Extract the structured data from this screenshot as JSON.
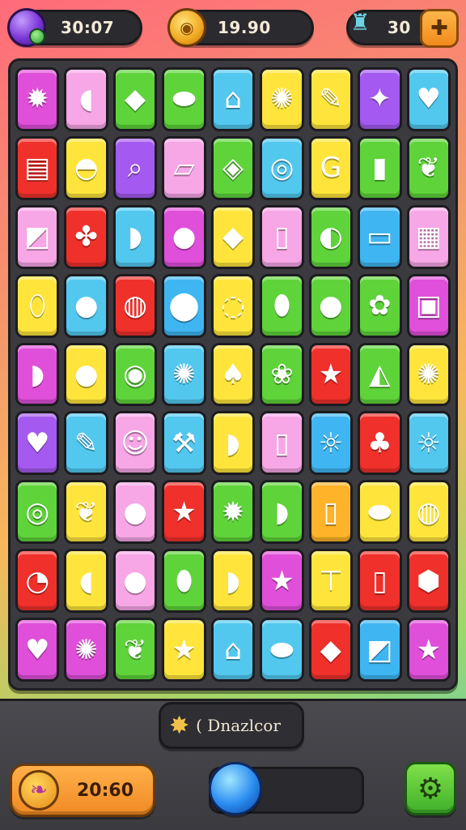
{
  "hud": {
    "gems": "30:07",
    "coins": "19.90",
    "cups": "30",
    "icons": {
      "gems": "gem-icon",
      "coins": "coin-icon",
      "cups": "trophy-lamp-icon",
      "shop": "shop-plus-icon"
    }
  },
  "board": {
    "rows": 9,
    "cols": 9,
    "tiles": [
      [
        {
          "c": "magenta",
          "g": "✹",
          "n": "virus"
        },
        {
          "c": "pink",
          "g": "◖",
          "n": "capsule"
        },
        {
          "c": "green",
          "g": "◆",
          "n": "drop"
        },
        {
          "c": "green",
          "g": "⬬",
          "n": "pin"
        },
        {
          "c": "lightblue",
          "g": "⌂",
          "n": "robot"
        },
        {
          "c": "yellow",
          "g": "✺",
          "n": "cookie"
        },
        {
          "c": "yellow",
          "g": "✎",
          "n": "tool"
        },
        {
          "c": "purple",
          "g": "✦",
          "n": "star"
        },
        {
          "c": "lightblue",
          "g": "♥",
          "n": "heart"
        }
      ],
      [
        {
          "c": "red",
          "g": "▤",
          "n": "jar"
        },
        {
          "c": "yellow",
          "g": "◓",
          "n": "bell"
        },
        {
          "c": "purple",
          "g": "⌕",
          "n": "horn"
        },
        {
          "c": "pink",
          "g": "▱",
          "n": "box"
        },
        {
          "c": "green",
          "g": "◈",
          "n": "gem"
        },
        {
          "c": "lightblue",
          "g": "◎",
          "n": "ring"
        },
        {
          "c": "yellow",
          "g": "G",
          "n": "letter"
        },
        {
          "c": "green",
          "g": "▮",
          "n": "battery"
        },
        {
          "c": "green",
          "g": "❦",
          "n": "leaf"
        }
      ],
      [
        {
          "c": "pink",
          "g": "◩",
          "n": "cube"
        },
        {
          "c": "red",
          "g": "✤",
          "n": "blob"
        },
        {
          "c": "lightblue",
          "g": "◗",
          "n": "leaf-drop"
        },
        {
          "c": "magenta",
          "g": "●",
          "n": "fruit"
        },
        {
          "c": "yellow",
          "g": "◆",
          "n": "crystal"
        },
        {
          "c": "pink",
          "g": "▯",
          "n": "tag"
        },
        {
          "c": "green",
          "g": "◐",
          "n": "banana"
        },
        {
          "c": "blue",
          "g": "▭",
          "n": "device"
        },
        {
          "c": "pink",
          "g": "▦",
          "n": "brick"
        }
      ],
      [
        {
          "c": "yellow",
          "g": "⬯",
          "n": "seed"
        },
        {
          "c": "lightblue",
          "g": "●",
          "n": "orb"
        },
        {
          "c": "red",
          "g": "◍",
          "n": "ring"
        },
        {
          "c": "blue",
          "g": "⬤",
          "n": "berry"
        },
        {
          "c": "yellow",
          "g": "◌",
          "n": "donut"
        },
        {
          "c": "green",
          "g": "⬮",
          "n": "pepper"
        },
        {
          "c": "green",
          "g": "●",
          "n": "apple"
        },
        {
          "c": "green",
          "g": "✿",
          "n": "grape"
        },
        {
          "c": "magenta",
          "g": "▣",
          "n": "bin"
        }
      ],
      [
        {
          "c": "magenta",
          "g": "◗",
          "n": "drop"
        },
        {
          "c": "yellow",
          "g": "●",
          "n": "ball"
        },
        {
          "c": "green",
          "g": "◉",
          "n": "ring"
        },
        {
          "c": "lightblue",
          "g": "✺",
          "n": "gear"
        },
        {
          "c": "yellow",
          "g": "♠",
          "n": "heart-leaf"
        },
        {
          "c": "green",
          "g": "❀",
          "n": "clover"
        },
        {
          "c": "red",
          "g": "★",
          "n": "star"
        },
        {
          "c": "green",
          "g": "◭",
          "n": "bug"
        },
        {
          "c": "yellow",
          "g": "✺",
          "n": "cookie"
        }
      ],
      [
        {
          "c": "purple",
          "g": "♥",
          "n": "heart"
        },
        {
          "c": "lightblue",
          "g": "✎",
          "n": "brush"
        },
        {
          "c": "pink",
          "g": "☺",
          "n": "smile"
        },
        {
          "c": "lightblue",
          "g": "⚒",
          "n": "pick"
        },
        {
          "c": "yellow",
          "g": "◗",
          "n": "drop"
        },
        {
          "c": "pink",
          "g": "▯",
          "n": "tag"
        },
        {
          "c": "blue",
          "g": "☼",
          "n": "sun"
        },
        {
          "c": "red",
          "g": "♣",
          "n": "blob"
        },
        {
          "c": "lightblue",
          "g": "☼",
          "n": "sun"
        }
      ],
      [
        {
          "c": "green",
          "g": "◎",
          "n": "swirl"
        },
        {
          "c": "yellow",
          "g": "❦",
          "n": "leaf"
        },
        {
          "c": "pink",
          "g": "●",
          "n": "orb"
        },
        {
          "c": "red",
          "g": "★",
          "n": "star"
        },
        {
          "c": "green",
          "g": "✹",
          "n": "bug"
        },
        {
          "c": "green",
          "g": "◗",
          "n": "bubble"
        },
        {
          "c": "orange",
          "g": "▯",
          "n": "tag"
        },
        {
          "c": "yellow",
          "g": "⬬",
          "n": "pin"
        },
        {
          "c": "yellow",
          "g": "◍",
          "n": "planet"
        }
      ],
      [
        {
          "c": "red",
          "g": "◔",
          "n": "leaf"
        },
        {
          "c": "yellow",
          "g": "◖",
          "n": "feather"
        },
        {
          "c": "pink",
          "g": "●",
          "n": "orb"
        },
        {
          "c": "green",
          "g": "⬮",
          "n": "eggplant"
        },
        {
          "c": "yellow",
          "g": "◗",
          "n": "drop"
        },
        {
          "c": "magenta",
          "g": "★",
          "n": "star"
        },
        {
          "c": "yellow",
          "g": "⊤",
          "n": "hammer"
        },
        {
          "c": "red",
          "g": "▯",
          "n": "tag"
        },
        {
          "c": "red",
          "g": "⬢",
          "n": "shield"
        }
      ],
      [
        {
          "c": "magenta",
          "g": "♥",
          "n": "heart"
        },
        {
          "c": "magenta",
          "g": "✺",
          "n": "gear"
        },
        {
          "c": "green",
          "g": "❦",
          "n": "leaf"
        },
        {
          "c": "yellow",
          "g": "★",
          "n": "star"
        },
        {
          "c": "lightblue",
          "g": "⌂",
          "n": "house"
        },
        {
          "c": "lightblue",
          "g": "⬬",
          "n": "balloon"
        },
        {
          "c": "red",
          "g": "◆",
          "n": "box"
        },
        {
          "c": "blue",
          "g": "◩",
          "n": "card"
        },
        {
          "c": "magenta",
          "g": "★",
          "n": "star"
        }
      ]
    ]
  },
  "bottom": {
    "powerup_label": "( Dnazlcor",
    "timer": "20:60",
    "progress": 0.0,
    "icons": {
      "powerup": "star-powerup-icon",
      "timer": "bird-icon",
      "settings": "gear-icon"
    }
  },
  "colors": {
    "green": "#5fd33a",
    "pink": "#f7a6e6",
    "magenta": "#e04fd9",
    "yellow": "#ffe53b",
    "blue": "#3fb6f2",
    "red": "#f0302b",
    "purple": "#a45af0",
    "orange": "#ffb328",
    "lightblue": "#52c8ef"
  }
}
